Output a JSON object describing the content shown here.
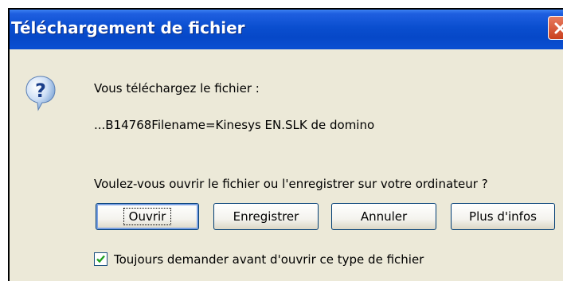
{
  "dialog": {
    "title": "Téléchargement de fichier",
    "close_icon": "close-icon",
    "question_icon": "question-icon",
    "line1": "Vous téléchargez le fichier :",
    "filename": "...B14768Filename=Kinesys EN.SLK de domino",
    "prompt": "Voulez-vous ouvrir le fichier ou l'enregistrer sur votre ordinateur ?",
    "buttons": {
      "open": "Ouvrir",
      "save": "Enregistrer",
      "cancel": "Annuler",
      "more_info": "Plus d'infos"
    },
    "checkbox": {
      "label": "Toujours demander avant d'ouvrir ce type de fichier",
      "checked": true
    }
  },
  "colors": {
    "titlebar": "#0a4ecf",
    "body": "#ece9d8",
    "close": "#c9401e",
    "check": "#21a121"
  }
}
